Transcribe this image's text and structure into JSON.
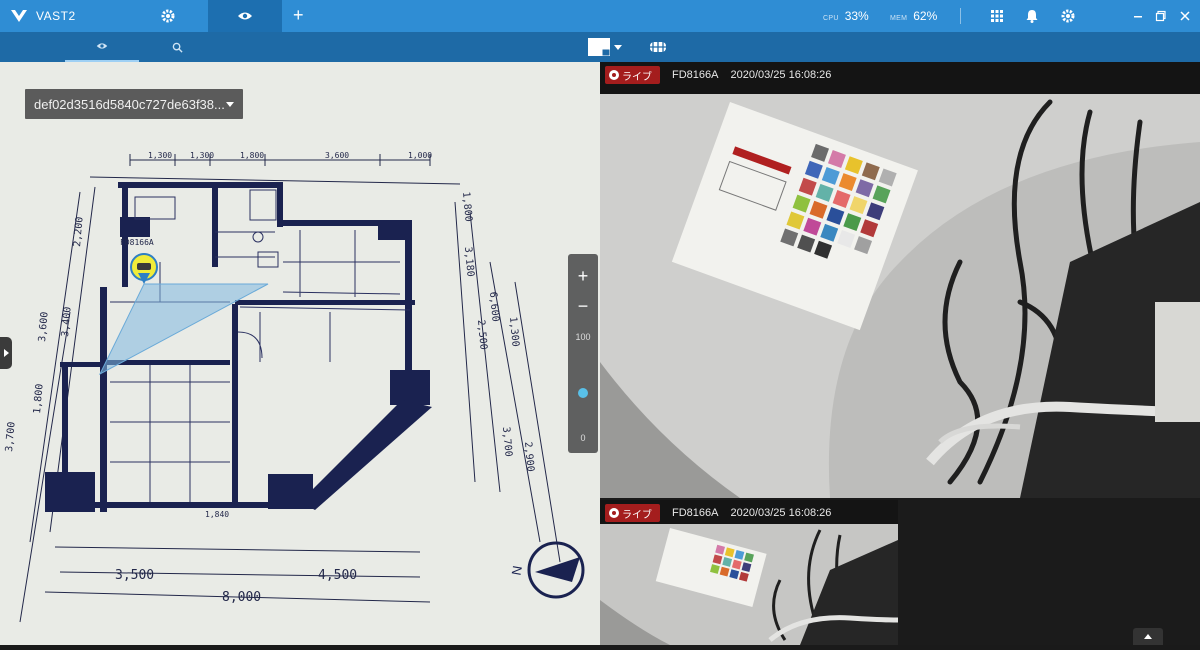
{
  "app": {
    "name": "VAST2"
  },
  "topbar": {
    "cpu_label": "CPU",
    "cpu_value": "33%",
    "mem_label": "MEM",
    "mem_value": "62%"
  },
  "map": {
    "selector_value": "def02d3516d5840c727de63f38...",
    "zoom_plus": "+",
    "zoom_minus": "−",
    "zoom_max": "100",
    "zoom_min": "0",
    "zoom_level": 0.45,
    "camera_label": "FD8166A",
    "dimensions": {
      "top": [
        "1,300",
        "1,300",
        "1,800",
        "3,600",
        "1,000"
      ],
      "bottom_left": "3,500",
      "bottom_right": "4,500",
      "bottom_total": "8,000",
      "left": [
        "2,200",
        "3,400",
        "3,600",
        "1,800",
        "3,700"
      ],
      "right": [
        "1,800",
        "3,180",
        "6,600",
        "2,500",
        "1,300",
        "3,700",
        "2,900"
      ],
      "inner": "1,840",
      "north": "N"
    }
  },
  "cameras": [
    {
      "live_label": "ライブ",
      "name": "FD8166A",
      "timestamp": "2020/03/25 16:08:26"
    },
    {
      "live_label": "ライブ",
      "name": "FD8166A",
      "timestamp": "2020/03/25 16:08:26"
    }
  ],
  "colors": {
    "topbar": "#2f8dd4",
    "subbar": "#1e6aa6",
    "live": "#a41d1d",
    "accent": "#59c0e8"
  }
}
